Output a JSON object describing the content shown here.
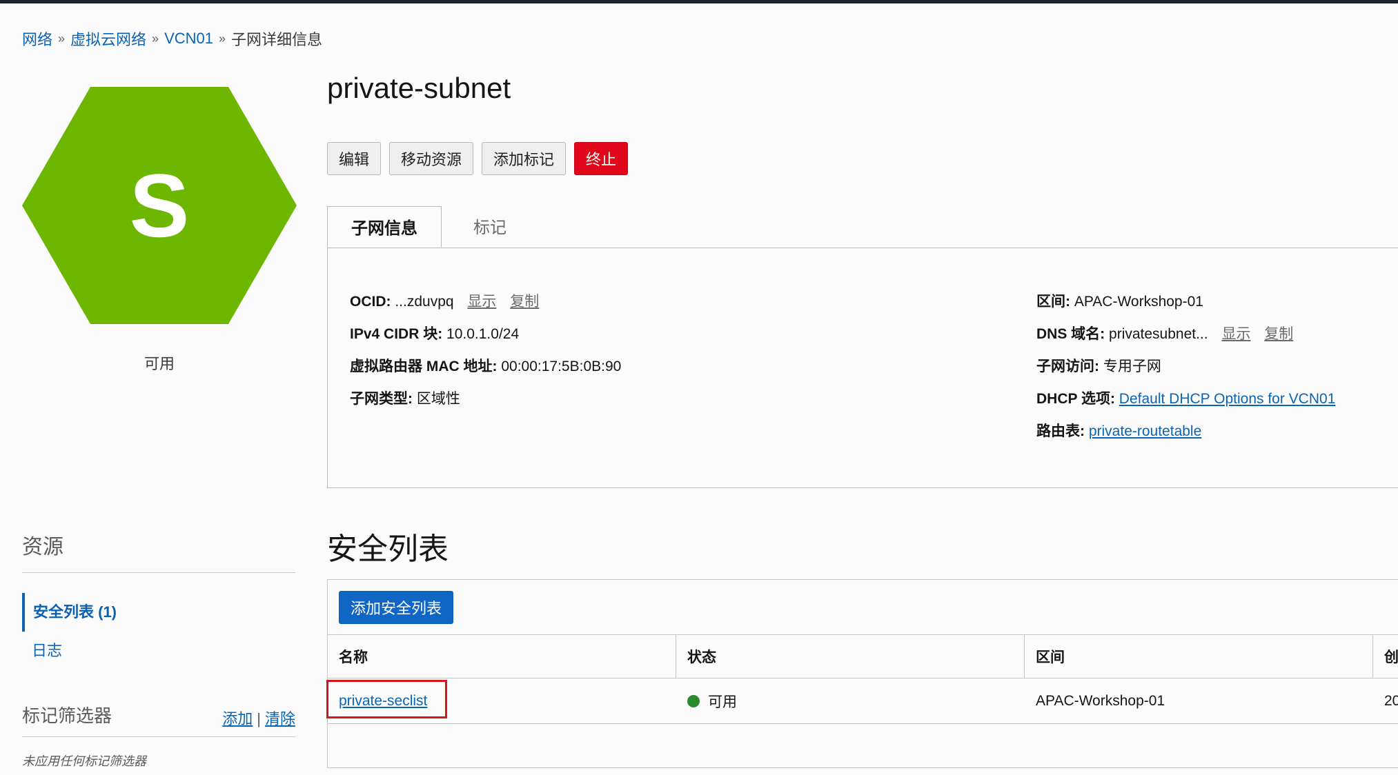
{
  "breadcrumb": {
    "items": [
      "网络",
      "虚拟云网络",
      "VCN01"
    ],
    "current": "子网详细信息",
    "separator": "»"
  },
  "resource_icon": {
    "letter": "S",
    "color": "#6eb700",
    "status": "可用"
  },
  "page": {
    "title": "private-subnet"
  },
  "actions": {
    "edit": "编辑",
    "move": "移动资源",
    "add_tags": "添加标记",
    "terminate": "终止"
  },
  "tabs": {
    "info": "子网信息",
    "tags": "标记"
  },
  "info": {
    "ocid": {
      "label": "OCID:",
      "value": "...zduvpq",
      "show": "显示",
      "copy": "复制"
    },
    "cidr": {
      "label": "IPv4 CIDR 块:",
      "value": "10.0.1.0/24"
    },
    "mac": {
      "label": "虚拟路由器 MAC 地址:",
      "value": "00:00:17:5B:0B:90"
    },
    "type": {
      "label": "子网类型:",
      "value": "区域性"
    },
    "compartment": {
      "label": "区间:",
      "value": "APAC-Workshop-01"
    },
    "dns": {
      "label": "DNS 域名:",
      "value": "privatesubnet...",
      "show": "显示",
      "copy": "复制"
    },
    "access": {
      "label": "子网访问:",
      "value": "专用子网"
    },
    "dhcp": {
      "label": "DHCP 选项:",
      "value": "Default DHCP Options for VCN01"
    },
    "route": {
      "label": "路由表:",
      "value": "private-routetable"
    }
  },
  "resources": {
    "title": "资源",
    "items": [
      {
        "label": "安全列表 (1)",
        "active": true
      },
      {
        "label": "日志",
        "active": false
      }
    ]
  },
  "tag_filter": {
    "title": "标记筛选器",
    "add": "添加",
    "separator": "|",
    "clear": "清除",
    "empty": "未应用任何标记筛选器"
  },
  "security_lists": {
    "title": "安全列表",
    "add_button": "添加安全列表",
    "columns": [
      "名称",
      "状态",
      "区间",
      "创"
    ],
    "rows": [
      {
        "name": "private-seclist",
        "status": "可用",
        "compartment": "APAC-Workshop-01",
        "created": "20"
      }
    ],
    "status_color": "#2b8a2b"
  },
  "colors": {
    "link": "#0a64b4",
    "danger": "#e2061b",
    "primary": "#0f66c5",
    "highlight": "#d6141c"
  }
}
